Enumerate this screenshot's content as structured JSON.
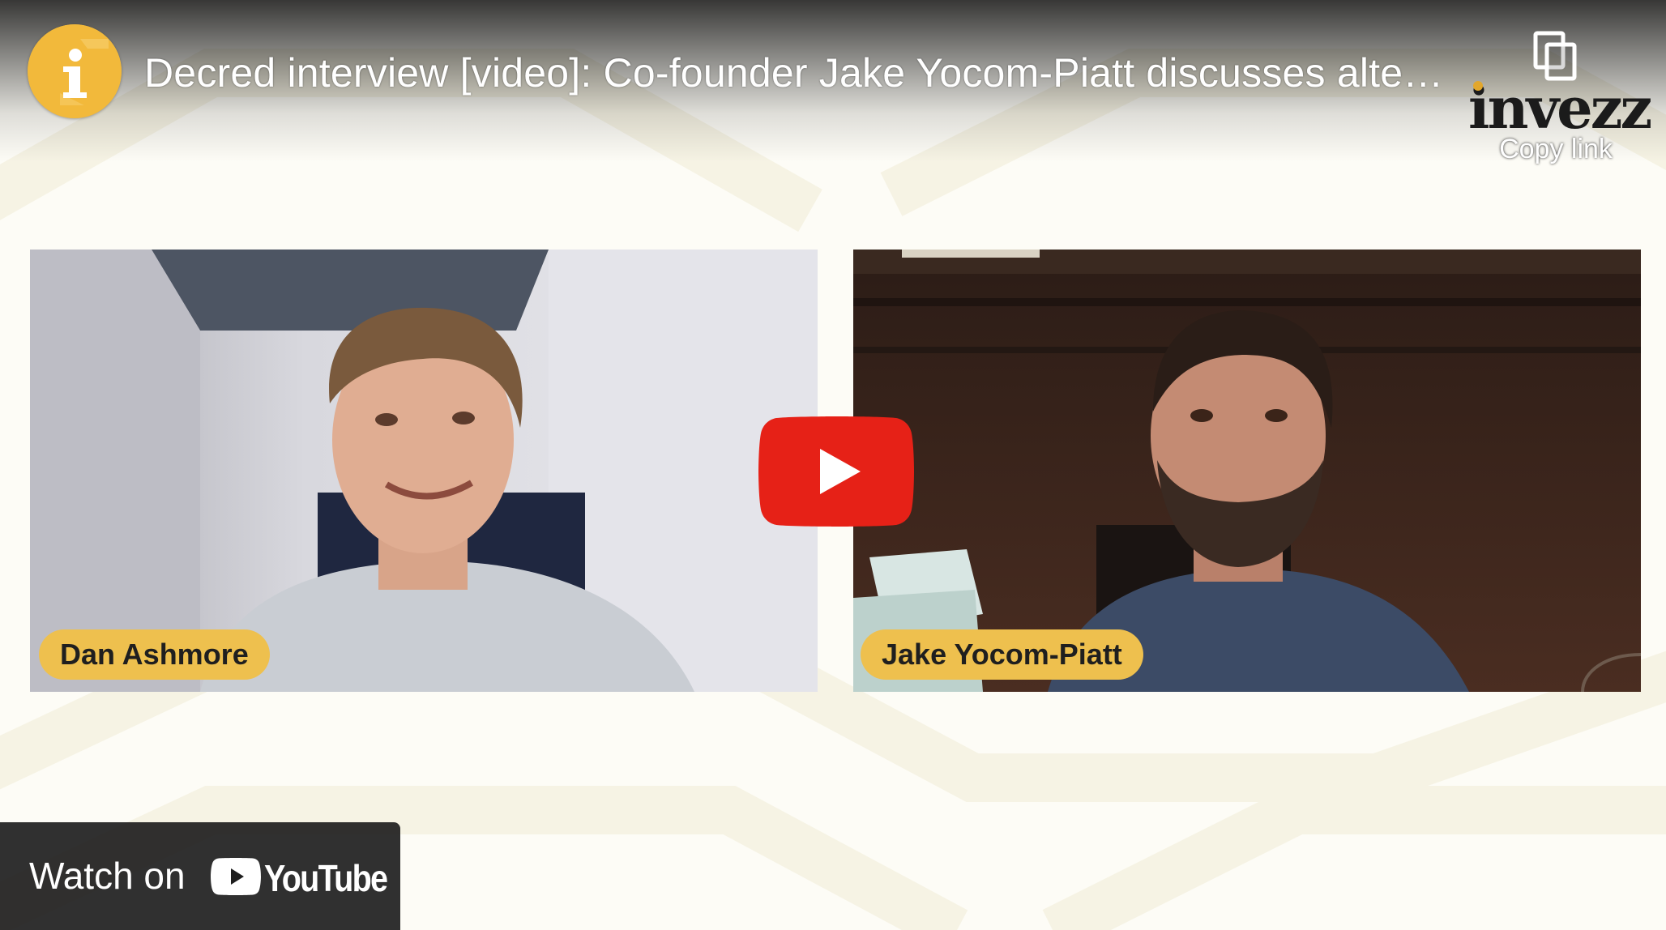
{
  "video": {
    "title": "Decred interview [video]: Co-founder Jake Yocom-Piatt discusses alte…",
    "channel_avatar_letter": "i"
  },
  "copy_link": {
    "label": "Copy link",
    "icon": "copy-icon"
  },
  "brand": {
    "logo_text": "invezz"
  },
  "participants": [
    {
      "name": "Dan Ashmore"
    },
    {
      "name": "Jake Yocom-Piatt"
    }
  ],
  "play_button": {
    "icon": "play-icon"
  },
  "watch_on": {
    "label": "Watch on",
    "service": "YouTube"
  },
  "colors": {
    "accent_gold": "#f2b93b",
    "name_tag": "#eec04e",
    "play_red": "#e62117",
    "watch_bar": "#1e1e1e",
    "background": "#fdfcf6"
  }
}
